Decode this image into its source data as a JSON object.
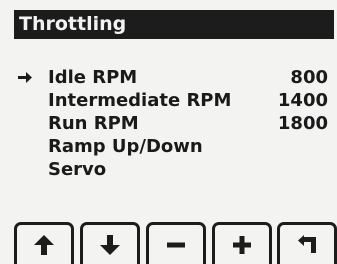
{
  "title": "Throttling",
  "menu": {
    "pointer_icon": "right-arrow-icon",
    "items": [
      {
        "label": "Idle RPM",
        "value": "800",
        "selected": true
      },
      {
        "label": "Intermediate RPM",
        "value": "1400",
        "selected": false
      },
      {
        "label": "Run RPM",
        "value": "1800",
        "selected": false
      },
      {
        "label": "Ramp Up/Down",
        "value": "",
        "selected": false
      },
      {
        "label": "Servo",
        "value": "",
        "selected": false
      }
    ]
  },
  "softkeys": [
    {
      "icon": "up-arrow-icon"
    },
    {
      "icon": "down-arrow-icon"
    },
    {
      "icon": "minus-icon"
    },
    {
      "icon": "plus-icon"
    },
    {
      "icon": "back-return-icon"
    }
  ],
  "colors": {
    "background": "#f3f3f2",
    "foreground": "#1c1c1c",
    "title_text": "#f2f2f2"
  }
}
